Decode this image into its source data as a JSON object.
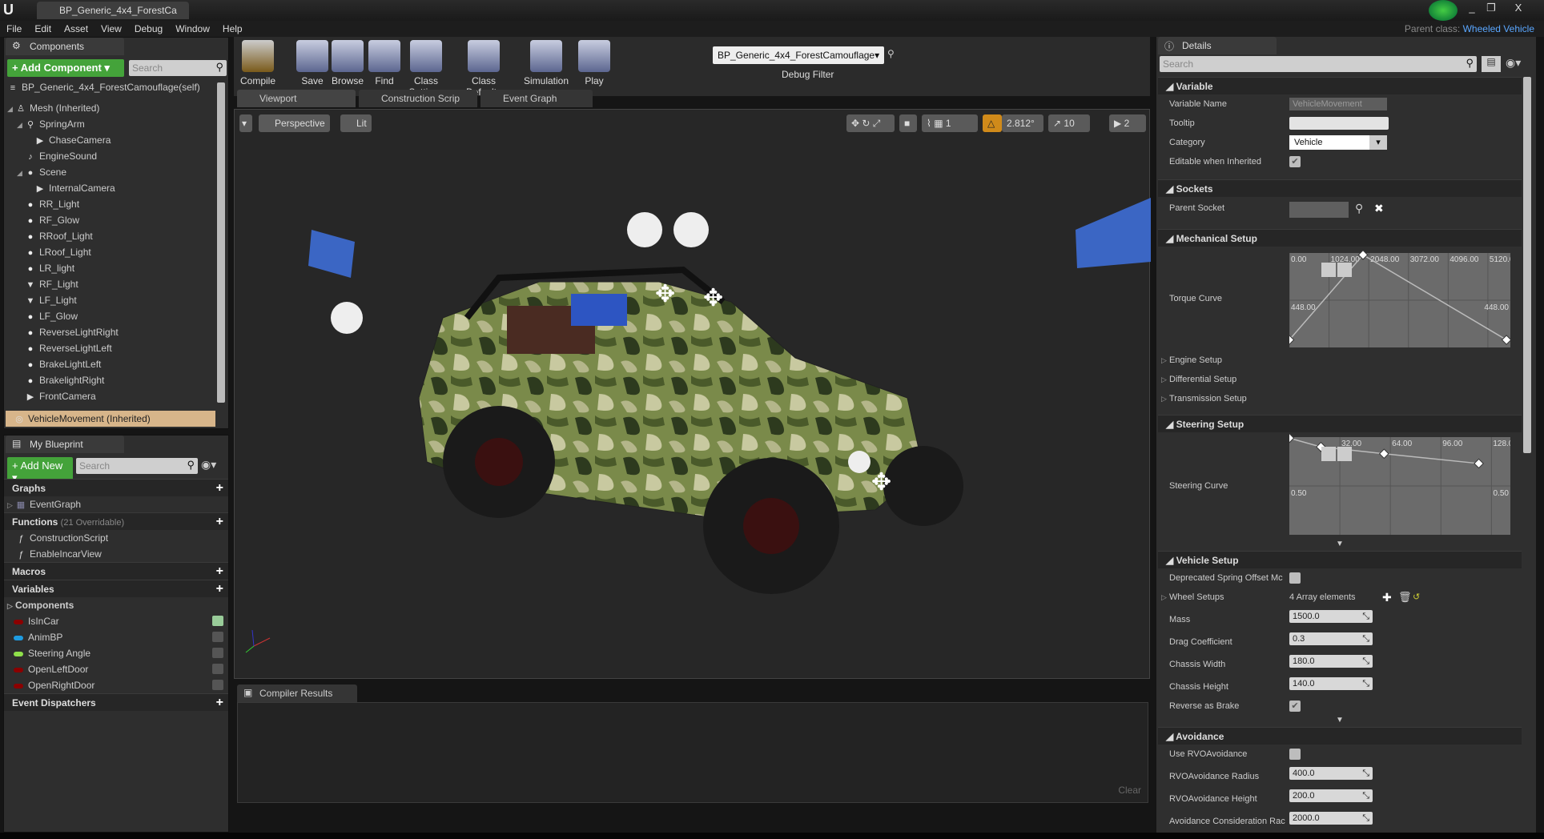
{
  "window": {
    "logo": "U",
    "doc_tab": "BP_Generic_4x4_ForestCa",
    "parent_class_label": "Parent class:",
    "parent_class": "Wheeled Vehicle",
    "min": "_",
    "max": "❐",
    "close": "X"
  },
  "menu": [
    "File",
    "Edit",
    "Asset",
    "View",
    "Debug",
    "Window",
    "Help"
  ],
  "components": {
    "tab": "Components",
    "add_label": "+ Add Component ▾",
    "search_placeholder": "Search",
    "root": "BP_Generic_4x4_ForestCamouflage(self)",
    "items": [
      {
        "label": "Mesh (Inherited)",
        "depth": 0,
        "expander": "◢",
        "icon": "mesh-icon"
      },
      {
        "label": "SpringArm",
        "depth": 1,
        "expander": "◢",
        "icon": "spring-arm-icon"
      },
      {
        "label": "ChaseCamera",
        "depth": 2,
        "icon": "camera-icon"
      },
      {
        "label": "EngineSound",
        "depth": 1,
        "icon": "audio-icon"
      },
      {
        "label": "Scene",
        "depth": 1,
        "expander": "◢",
        "icon": "scene-icon"
      },
      {
        "label": "InternalCamera",
        "depth": 2,
        "icon": "camera-icon"
      },
      {
        "label": "RR_Light",
        "depth": 1,
        "icon": "point-light-icon"
      },
      {
        "label": "RF_Glow",
        "depth": 1,
        "icon": "point-light-icon"
      },
      {
        "label": "RRoof_Light",
        "depth": 1,
        "icon": "point-light-icon"
      },
      {
        "label": "LRoof_Light",
        "depth": 1,
        "icon": "point-light-icon"
      },
      {
        "label": "LR_light",
        "depth": 1,
        "icon": "point-light-icon"
      },
      {
        "label": "RF_Light",
        "depth": 1,
        "icon": "spot-light-icon"
      },
      {
        "label": "LF_Light",
        "depth": 1,
        "icon": "spot-light-icon"
      },
      {
        "label": "LF_Glow",
        "depth": 1,
        "icon": "point-light-icon"
      },
      {
        "label": "ReverseLightRight",
        "depth": 1,
        "icon": "point-light-icon"
      },
      {
        "label": "ReverseLightLeft",
        "depth": 1,
        "icon": "point-light-icon"
      },
      {
        "label": "BrakeLightLeft",
        "depth": 1,
        "icon": "point-light-icon"
      },
      {
        "label": "BrakelightRight",
        "depth": 1,
        "icon": "point-light-icon"
      },
      {
        "label": "FrontCamera",
        "depth": 1,
        "icon": "camera-icon"
      }
    ],
    "selected": "VehicleMovement (Inherited)"
  },
  "blueprint": {
    "tab": "My Blueprint",
    "add_label": "+ Add New ▾",
    "search_placeholder": "Search",
    "graphs": {
      "title": "Graphs",
      "items": [
        "EventGraph"
      ]
    },
    "functions": {
      "title": "Functions",
      "note": "(21 Overridable)",
      "items": [
        "ConstructionScript",
        "EnableIncarView"
      ]
    },
    "macros": {
      "title": "Macros"
    },
    "variables": {
      "title": "Variables",
      "category": "Components",
      "items": [
        {
          "label": "IsInCar",
          "color": "#8b0000",
          "visible": true
        },
        {
          "label": "AnimBP",
          "color": "#1e9be0",
          "visible": false
        },
        {
          "label": "Steering Angle",
          "color": "#8fe04a",
          "visible": false
        },
        {
          "label": "OpenLeftDoor",
          "color": "#8b0000",
          "visible": false
        },
        {
          "label": "OpenRightDoor",
          "color": "#8b0000",
          "visible": false
        }
      ]
    },
    "dispatchers": {
      "title": "Event Dispatchers"
    }
  },
  "toolbar": {
    "buttons": [
      "Compile",
      "Save",
      "Browse",
      "Find",
      "Class Settings",
      "Class Defaults",
      "Simulation",
      "Play"
    ],
    "debug_select": "BP_Generic_4x4_ForestCamouflage▾",
    "debug_label": "Debug Filter"
  },
  "editor_tabs": [
    "Viewport",
    "Construction Scrip",
    "Event Graph"
  ],
  "viewport": {
    "perspective": "Perspective",
    "lit": "Lit",
    "angle": "2.812°",
    "grid": "10",
    "cam_speed": "2",
    "scale": "1"
  },
  "compiler": {
    "tab": "Compiler Results",
    "clear": "Clear"
  },
  "details": {
    "tab": "Details",
    "search_placeholder": "Search",
    "variable": {
      "title": "Variable",
      "name_label": "Variable Name",
      "name_value": "VehicleMovement",
      "tooltip_label": "Tooltip",
      "tooltip_value": "",
      "category_label": "Category",
      "category_value": "Vehicle",
      "editable_label": "Editable when Inherited",
      "editable": true
    },
    "sockets": {
      "title": "Sockets",
      "parent_label": "Parent Socket"
    },
    "mechanical": {
      "title": "Mechanical Setup",
      "torque_label": "Torque Curve",
      "sub": [
        "Engine Setup",
        "Differential Setup",
        "Transmission Setup"
      ]
    },
    "steering": {
      "title": "Steering Setup",
      "curve_label": "Steering Curve"
    },
    "vehicle": {
      "title": "Vehicle Setup",
      "deprecated_label": "Deprecated Spring Offset Mc",
      "deprecated": false,
      "wheel_label": "Wheel Setups",
      "wheel_value": "4 Array elements",
      "fields": [
        {
          "label": "Mass",
          "value": "1500.0"
        },
        {
          "label": "Drag Coefficient",
          "value": "0.3"
        },
        {
          "label": "Chassis Width",
          "value": "180.0"
        },
        {
          "label": "Chassis Height",
          "value": "140.0"
        }
      ],
      "reverse_label": "Reverse as Brake",
      "reverse": true
    },
    "avoidance": {
      "title": "Avoidance",
      "use_label": "Use RVOAvoidance",
      "use": false,
      "fields": [
        {
          "label": "RVOAvoidance Radius",
          "value": "400.0"
        },
        {
          "label": "RVOAvoidance Height",
          "value": "200.0"
        },
        {
          "label": "Avoidance Consideration Rac",
          "value": "2000.0"
        }
      ]
    }
  },
  "chart_data": [
    {
      "type": "line",
      "xticks": [
        "0.00",
        "1024.00",
        "2048.00",
        "3072.00",
        "4096.00",
        "5120.00"
      ],
      "ylabel_left": "448.00",
      "ylabel_right": "448.00",
      "xlim": [
        0,
        5700
      ],
      "ylim": [
        0,
        1000
      ],
      "x": [
        0,
        1900,
        5600
      ],
      "y": [
        80,
        980,
        80
      ]
    },
    {
      "type": "line",
      "xticks": [
        "32.00",
        "64.00",
        "96.00",
        "128.00"
      ],
      "ylabel_left": "0.50",
      "ylabel_right": "0.50",
      "xlim": [
        0,
        140
      ],
      "ylim": [
        0,
        1.0
      ],
      "x": [
        0,
        20,
        60,
        120
      ],
      "y": [
        0.99,
        0.9,
        0.83,
        0.73
      ]
    }
  ]
}
